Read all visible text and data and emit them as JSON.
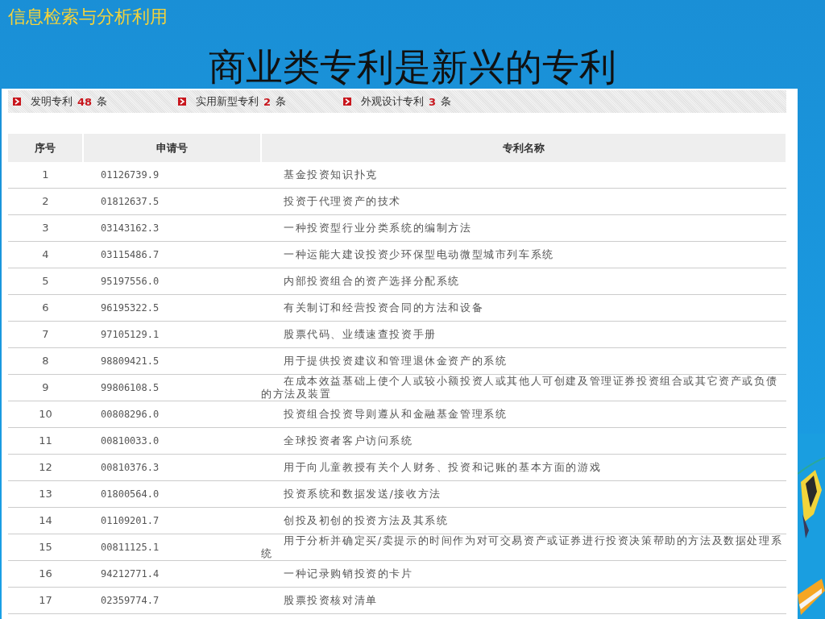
{
  "slide": {
    "header": "信息检索与分析利用",
    "title": "商业类专利是新兴的专利"
  },
  "summary": [
    {
      "label": "发明专利",
      "count": "48",
      "unit": "条"
    },
    {
      "label": "实用新型专利",
      "count": "2",
      "unit": "条"
    },
    {
      "label": "外观设计专利",
      "count": "3",
      "unit": "条"
    }
  ],
  "table": {
    "columns": [
      "序号",
      "申请号",
      "专利名称"
    ],
    "rows": [
      [
        "1",
        "01126739.9",
        "基金投资知识扑克"
      ],
      [
        "2",
        "01812637.5",
        "投资于代理资产的技术"
      ],
      [
        "3",
        "03143162.3",
        "一种投资型行业分类系统的编制方法"
      ],
      [
        "4",
        "03115486.7",
        "一种运能大建设投资少环保型电动微型城市列车系统"
      ],
      [
        "5",
        "95197556.0",
        "内部投资组合的资产选择分配系统"
      ],
      [
        "6",
        "96195322.5",
        "有关制订和经营投资合同的方法和设备"
      ],
      [
        "7",
        "97105129.1",
        "股票代码、业绩速查投资手册"
      ],
      [
        "8",
        "98809421.5",
        "用于提供投资建议和管理退休金资产的系统"
      ],
      [
        "9",
        "99806108.5",
        "在成本效益基础上使个人或较小额投资人或其他人可创建及管理证券投资组合或其它资产或负债的方法及装置"
      ],
      [
        "10",
        "00808296.0",
        "投资组合投资导则遵从和金融基金管理系统"
      ],
      [
        "11",
        "00810033.0",
        "全球投资者客户访问系统"
      ],
      [
        "12",
        "00810376.3",
        "用于向儿童教授有关个人财务、投资和记账的基本方面的游戏"
      ],
      [
        "13",
        "01800564.0",
        "投资系统和数据发送/接收方法"
      ],
      [
        "14",
        "01109201.7",
        "创投及初创的投资方法及其系统"
      ],
      [
        "15",
        "00811125.1",
        "用于分析并确定买/卖提示的时间作为对可交易资产或证券进行投资决策帮助的方法及数据处理系统"
      ],
      [
        "16",
        "94212771.4",
        "一种记录购销投资的卡片"
      ],
      [
        "17",
        "02359774.7",
        "股票投资核对清单"
      ]
    ]
  }
}
